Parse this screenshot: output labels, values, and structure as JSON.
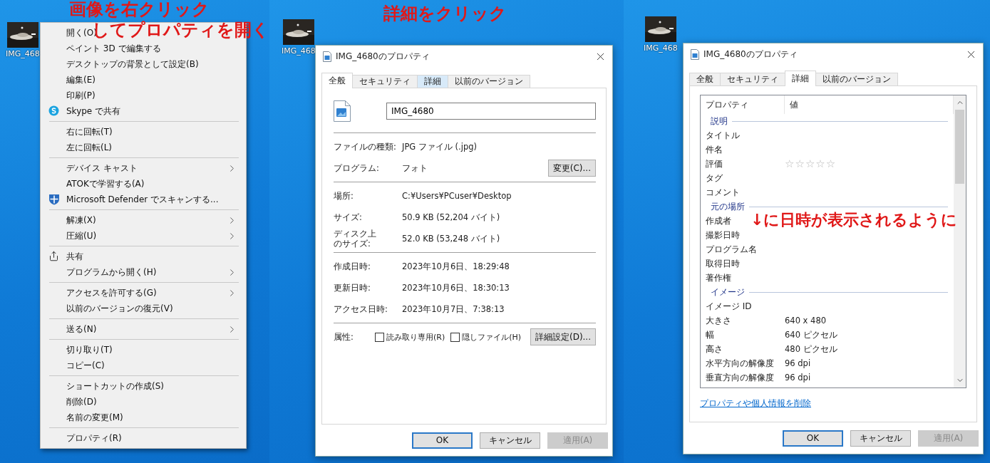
{
  "step1": {
    "annotation": [
      "画像を右クリック",
      "してプロパティを開く"
    ],
    "desktop_icon": {
      "label": "IMG_468"
    },
    "context_menu": {
      "items": [
        {
          "kind": "item",
          "label": "開く(O)"
        },
        {
          "kind": "item",
          "label": "ペイント 3D で編集する"
        },
        {
          "kind": "item",
          "label": "デスクトップの背景として設定(B)"
        },
        {
          "kind": "item",
          "label": "編集(E)"
        },
        {
          "kind": "item",
          "label": "印刷(P)"
        },
        {
          "kind": "skype",
          "label": "Skype で共有"
        },
        {
          "kind": "separator"
        },
        {
          "kind": "item",
          "label": "右に回転(T)"
        },
        {
          "kind": "item",
          "label": "左に回転(L)"
        },
        {
          "kind": "separator"
        },
        {
          "kind": "item",
          "label": "デバイス キャスト",
          "submenu": true
        },
        {
          "kind": "item",
          "label": "ATOKで学習する(A)"
        },
        {
          "kind": "defender",
          "label": "Microsoft Defender でスキャンする..."
        },
        {
          "kind": "separator"
        },
        {
          "kind": "item",
          "label": "解凍(X)",
          "submenu": true
        },
        {
          "kind": "item",
          "label": "圧縮(U)",
          "submenu": true
        },
        {
          "kind": "separator"
        },
        {
          "kind": "share",
          "label": "共有"
        },
        {
          "kind": "item",
          "label": "プログラムから開く(H)",
          "submenu": true
        },
        {
          "kind": "separator"
        },
        {
          "kind": "item",
          "label": "アクセスを許可する(G)",
          "submenu": true
        },
        {
          "kind": "item",
          "label": "以前のバージョンの復元(V)"
        },
        {
          "kind": "separator"
        },
        {
          "kind": "item",
          "label": "送る(N)",
          "submenu": true
        },
        {
          "kind": "separator"
        },
        {
          "kind": "item",
          "label": "切り取り(T)"
        },
        {
          "kind": "item",
          "label": "コピー(C)"
        },
        {
          "kind": "separator"
        },
        {
          "kind": "item",
          "label": "ショートカットの作成(S)"
        },
        {
          "kind": "item",
          "label": "削除(D)"
        },
        {
          "kind": "item",
          "label": "名前の変更(M)"
        },
        {
          "kind": "separator"
        },
        {
          "kind": "item",
          "label": "プロパティ(R)"
        }
      ]
    }
  },
  "step2": {
    "annotation": "詳細をクリック",
    "desktop_icon": {
      "label": "IMG_468"
    },
    "dialog": {
      "title": "IMG_4680のプロパティ",
      "tabs": [
        {
          "label": "全般",
          "selected": true,
          "highlighted": false
        },
        {
          "label": "セキュリティ",
          "selected": false,
          "highlighted": false
        },
        {
          "label": "詳細",
          "selected": false,
          "highlighted": true
        },
        {
          "label": "以前のバージョン",
          "selected": false,
          "highlighted": false
        }
      ],
      "file_name": "IMG_4680",
      "sections": [
        [
          {
            "label": "ファイルの種類:",
            "value": "JPG ファイル (.jpg)"
          },
          {
            "label": "プログラム:",
            "value": "フォト",
            "button": "変更(C)..."
          }
        ],
        [
          {
            "label": "場所:",
            "value": "C:¥Users¥PCuser¥Desktop"
          },
          {
            "label": "サイズ:",
            "value": "50.9 KB (52,204 バイト)"
          },
          {
            "label": [
              "ディスク上",
              "のサイズ:"
            ],
            "value": "52.0 KB (53,248 バイト)"
          }
        ],
        [
          {
            "label": "作成日時:",
            "value": "2023年10月6日、18:29:48"
          },
          {
            "label": "更新日時:",
            "value": "2023年10月6日、18:30:13"
          },
          {
            "label": "アクセス日時:",
            "value": "2023年10月7日、7:38:13"
          }
        ]
      ],
      "attributes": {
        "label": "属性:",
        "checkboxes": [
          {
            "label": "読み取り専用(R)",
            "checked": false
          },
          {
            "label": "隠しファイル(H)",
            "checked": false
          }
        ],
        "button": "詳細設定(D)..."
      },
      "buttons": [
        {
          "label": "OK",
          "kind": "default"
        },
        {
          "label": "キャンセル",
          "kind": "normal"
        },
        {
          "label": "適用(A)",
          "kind": "disabled"
        }
      ]
    }
  },
  "step3": {
    "annotation": "↓に日時が表示されるように",
    "desktop_icon": {
      "label": "IMG_468"
    },
    "dialog": {
      "title": "IMG_4680のプロパティ",
      "tabs": [
        {
          "label": "全般",
          "selected": false,
          "highlighted": false
        },
        {
          "label": "セキュリティ",
          "selected": false,
          "highlighted": false
        },
        {
          "label": "詳細",
          "selected": true,
          "highlighted": false
        },
        {
          "label": "以前のバージョン",
          "selected": false,
          "highlighted": false
        }
      ],
      "columns": [
        "プロパティ",
        "値"
      ],
      "groups": [
        {
          "heading": "説明",
          "rows": [
            {
              "kind": "text",
              "name": "タイトル"
            },
            {
              "kind": "text",
              "name": "件名"
            },
            {
              "kind": "rating",
              "name": "評価",
              "stars": 0
            },
            {
              "kind": "text",
              "name": "タグ"
            },
            {
              "kind": "text",
              "name": "コメント"
            }
          ]
        },
        {
          "heading": "元の場所",
          "rows": [
            {
              "kind": "text",
              "name": "作成者"
            },
            {
              "kind": "text",
              "name": "撮影日時"
            },
            {
              "kind": "text",
              "name": "プログラム名"
            },
            {
              "kind": "text",
              "name": "取得日時"
            },
            {
              "kind": "text",
              "name": "著作権"
            }
          ]
        },
        {
          "heading": "イメージ",
          "rows": [
            {
              "kind": "text",
              "name": "イメージ ID"
            },
            {
              "kind": "text",
              "name": "大きさ",
              "value": "640 x 480"
            },
            {
              "kind": "text",
              "name": "幅",
              "value": "640 ピクセル"
            },
            {
              "kind": "text",
              "name": "高さ",
              "value": "480 ピクセル"
            },
            {
              "kind": "text",
              "name": "水平方向の解像度",
              "value": "96 dpi"
            },
            {
              "kind": "text",
              "name": "垂直方向の解像度",
              "value": "96 dpi"
            }
          ]
        }
      ],
      "link": "プロパティや個人情報を削除",
      "buttons": [
        {
          "label": "OK",
          "kind": "default"
        },
        {
          "label": "キャンセル",
          "kind": "normal"
        },
        {
          "label": "適用(A)",
          "kind": "disabled"
        }
      ]
    }
  }
}
